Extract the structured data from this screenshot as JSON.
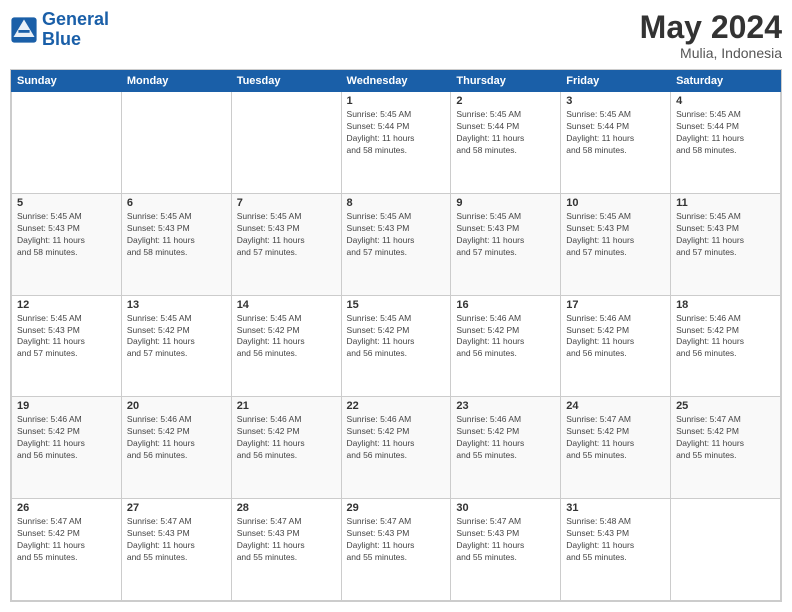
{
  "logo": {
    "text_general": "General",
    "text_blue": "Blue"
  },
  "header": {
    "title": "May 2024",
    "subtitle": "Mulia, Indonesia"
  },
  "weekdays": [
    "Sunday",
    "Monday",
    "Tuesday",
    "Wednesday",
    "Thursday",
    "Friday",
    "Saturday"
  ],
  "weeks": [
    [
      {
        "day": "",
        "info": ""
      },
      {
        "day": "",
        "info": ""
      },
      {
        "day": "",
        "info": ""
      },
      {
        "day": "1",
        "info": "Sunrise: 5:45 AM\nSunset: 5:44 PM\nDaylight: 11 hours\nand 58 minutes."
      },
      {
        "day": "2",
        "info": "Sunrise: 5:45 AM\nSunset: 5:44 PM\nDaylight: 11 hours\nand 58 minutes."
      },
      {
        "day": "3",
        "info": "Sunrise: 5:45 AM\nSunset: 5:44 PM\nDaylight: 11 hours\nand 58 minutes."
      },
      {
        "day": "4",
        "info": "Sunrise: 5:45 AM\nSunset: 5:44 PM\nDaylight: 11 hours\nand 58 minutes."
      }
    ],
    [
      {
        "day": "5",
        "info": "Sunrise: 5:45 AM\nSunset: 5:43 PM\nDaylight: 11 hours\nand 58 minutes."
      },
      {
        "day": "6",
        "info": "Sunrise: 5:45 AM\nSunset: 5:43 PM\nDaylight: 11 hours\nand 58 minutes."
      },
      {
        "day": "7",
        "info": "Sunrise: 5:45 AM\nSunset: 5:43 PM\nDaylight: 11 hours\nand 57 minutes."
      },
      {
        "day": "8",
        "info": "Sunrise: 5:45 AM\nSunset: 5:43 PM\nDaylight: 11 hours\nand 57 minutes."
      },
      {
        "day": "9",
        "info": "Sunrise: 5:45 AM\nSunset: 5:43 PM\nDaylight: 11 hours\nand 57 minutes."
      },
      {
        "day": "10",
        "info": "Sunrise: 5:45 AM\nSunset: 5:43 PM\nDaylight: 11 hours\nand 57 minutes."
      },
      {
        "day": "11",
        "info": "Sunrise: 5:45 AM\nSunset: 5:43 PM\nDaylight: 11 hours\nand 57 minutes."
      }
    ],
    [
      {
        "day": "12",
        "info": "Sunrise: 5:45 AM\nSunset: 5:43 PM\nDaylight: 11 hours\nand 57 minutes."
      },
      {
        "day": "13",
        "info": "Sunrise: 5:45 AM\nSunset: 5:42 PM\nDaylight: 11 hours\nand 57 minutes."
      },
      {
        "day": "14",
        "info": "Sunrise: 5:45 AM\nSunset: 5:42 PM\nDaylight: 11 hours\nand 56 minutes."
      },
      {
        "day": "15",
        "info": "Sunrise: 5:45 AM\nSunset: 5:42 PM\nDaylight: 11 hours\nand 56 minutes."
      },
      {
        "day": "16",
        "info": "Sunrise: 5:46 AM\nSunset: 5:42 PM\nDaylight: 11 hours\nand 56 minutes."
      },
      {
        "day": "17",
        "info": "Sunrise: 5:46 AM\nSunset: 5:42 PM\nDaylight: 11 hours\nand 56 minutes."
      },
      {
        "day": "18",
        "info": "Sunrise: 5:46 AM\nSunset: 5:42 PM\nDaylight: 11 hours\nand 56 minutes."
      }
    ],
    [
      {
        "day": "19",
        "info": "Sunrise: 5:46 AM\nSunset: 5:42 PM\nDaylight: 11 hours\nand 56 minutes."
      },
      {
        "day": "20",
        "info": "Sunrise: 5:46 AM\nSunset: 5:42 PM\nDaylight: 11 hours\nand 56 minutes."
      },
      {
        "day": "21",
        "info": "Sunrise: 5:46 AM\nSunset: 5:42 PM\nDaylight: 11 hours\nand 56 minutes."
      },
      {
        "day": "22",
        "info": "Sunrise: 5:46 AM\nSunset: 5:42 PM\nDaylight: 11 hours\nand 56 minutes."
      },
      {
        "day": "23",
        "info": "Sunrise: 5:46 AM\nSunset: 5:42 PM\nDaylight: 11 hours\nand 55 minutes."
      },
      {
        "day": "24",
        "info": "Sunrise: 5:47 AM\nSunset: 5:42 PM\nDaylight: 11 hours\nand 55 minutes."
      },
      {
        "day": "25",
        "info": "Sunrise: 5:47 AM\nSunset: 5:42 PM\nDaylight: 11 hours\nand 55 minutes."
      }
    ],
    [
      {
        "day": "26",
        "info": "Sunrise: 5:47 AM\nSunset: 5:42 PM\nDaylight: 11 hours\nand 55 minutes."
      },
      {
        "day": "27",
        "info": "Sunrise: 5:47 AM\nSunset: 5:43 PM\nDaylight: 11 hours\nand 55 minutes."
      },
      {
        "day": "28",
        "info": "Sunrise: 5:47 AM\nSunset: 5:43 PM\nDaylight: 11 hours\nand 55 minutes."
      },
      {
        "day": "29",
        "info": "Sunrise: 5:47 AM\nSunset: 5:43 PM\nDaylight: 11 hours\nand 55 minutes."
      },
      {
        "day": "30",
        "info": "Sunrise: 5:47 AM\nSunset: 5:43 PM\nDaylight: 11 hours\nand 55 minutes."
      },
      {
        "day": "31",
        "info": "Sunrise: 5:48 AM\nSunset: 5:43 PM\nDaylight: 11 hours\nand 55 minutes."
      },
      {
        "day": "",
        "info": ""
      }
    ]
  ]
}
